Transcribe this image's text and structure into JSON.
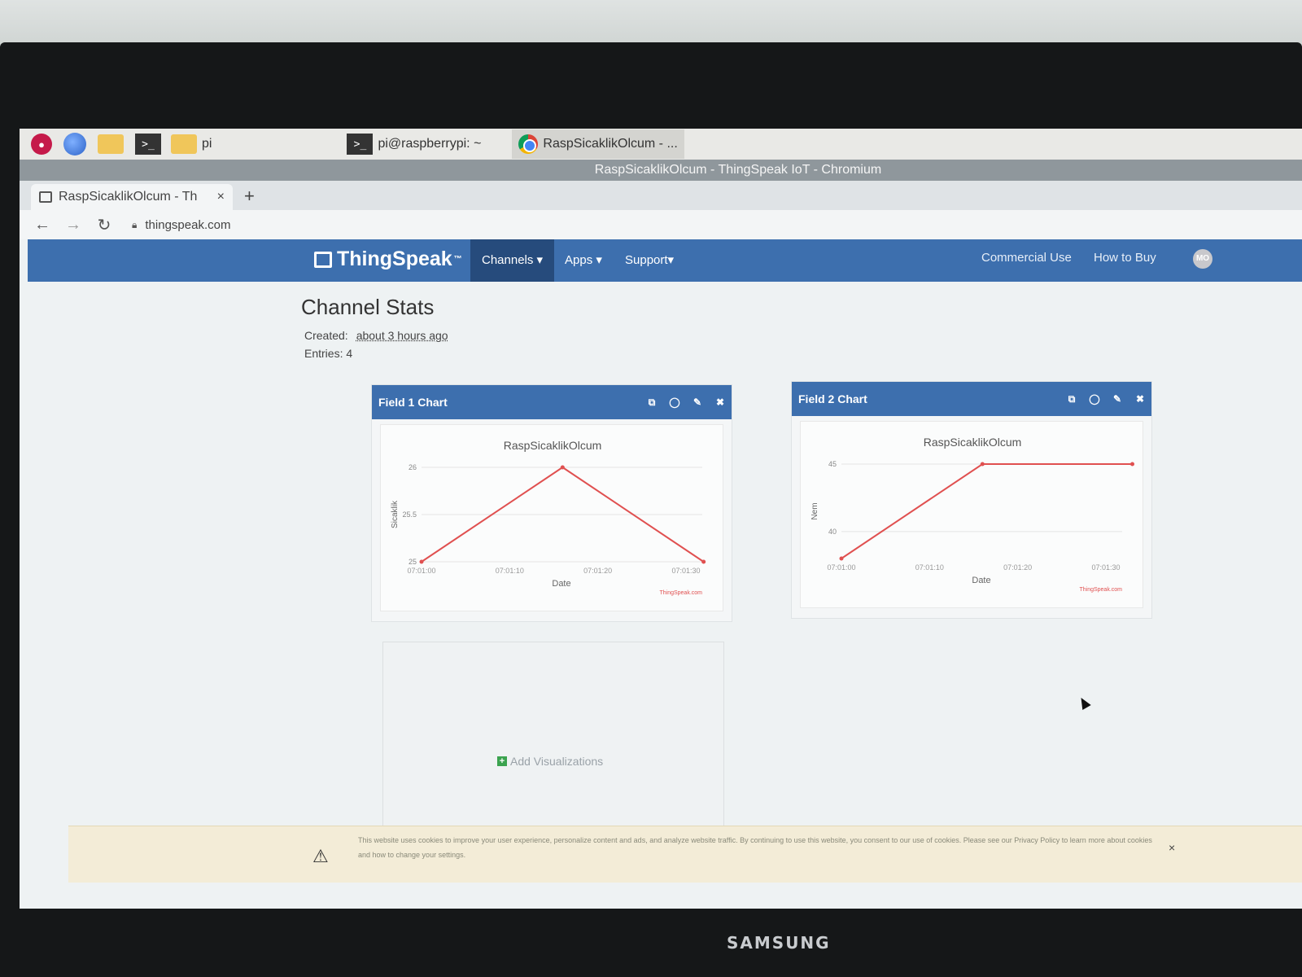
{
  "taskbar": {
    "folder_label": "pi",
    "tasks": [
      {
        "label": "pi@raspberrypi: ~"
      },
      {
        "label": "RaspSicaklikOlcum - ..."
      }
    ]
  },
  "window": {
    "title": "RaspSicaklikOlcum - ThingSpeak IoT - Chromium"
  },
  "browser": {
    "tab_title": "RaspSicaklikOlcum - Th",
    "tab_close": "×",
    "new_tab": "+",
    "url": "thingspeak.com"
  },
  "nav": {
    "logo": "ThingSpeak",
    "logo_tm": "™",
    "menus": [
      {
        "label": "Channels ▾"
      },
      {
        "label": "Apps ▾"
      },
      {
        "label": "Support▾"
      }
    ],
    "right": [
      {
        "label": "Commercial Use"
      },
      {
        "label": "How to Buy"
      }
    ],
    "avatar": "MO"
  },
  "stats": {
    "title": "Channel Stats",
    "created_label": "Created:",
    "created_value": "about 3 hours ago",
    "entries_label": "Entries:",
    "entries_value": "4"
  },
  "charts": [
    {
      "header": "Field 1 Chart"
    },
    {
      "header": "Field 2 Chart"
    }
  ],
  "chart_data": [
    {
      "type": "line",
      "title": "RaspSicaklikOlcum",
      "xlabel": "Date",
      "ylabel": "Sicaklik",
      "x_ticks": [
        "07:01:00",
        "07:01:10",
        "07:01:20",
        "07:01:30"
      ],
      "y_ticks": [
        25,
        25.5,
        26
      ],
      "ylim": [
        25,
        26
      ],
      "xlim_seconds": [
        0,
        30
      ],
      "points": [
        {
          "x": "07:01:00",
          "y": 25
        },
        {
          "x": "07:01:16",
          "y": 26
        },
        {
          "x": "07:01:32",
          "y": 25
        }
      ],
      "credit": "ThingSpeak.com",
      "color": "#e05050"
    },
    {
      "type": "line",
      "title": "RaspSicaklikOlcum",
      "xlabel": "Date",
      "ylabel": "Nem",
      "x_ticks": [
        "07:01:00",
        "07:01:10",
        "07:01:20",
        "07:01:30"
      ],
      "y_ticks": [
        40,
        45
      ],
      "ylim": [
        38,
        45
      ],
      "xlim_seconds": [
        0,
        30
      ],
      "points": [
        {
          "x": "07:01:00",
          "y": 38
        },
        {
          "x": "07:01:16",
          "y": 45
        },
        {
          "x": "07:01:33",
          "y": 45
        }
      ],
      "credit": "ThingSpeak.com",
      "color": "#e05050"
    }
  ],
  "add_viz": "Add Visualizations",
  "cookie": {
    "text": "This website uses cookies to improve your user experience, personalize content and ads, and analyze website traffic. By continuing to use this website, you consent to our use of cookies. Please see our Privacy Policy to learn more about cookies and how to change your settings.",
    "close": "×"
  },
  "monitor_brand": "SAMSUNG",
  "colors": {
    "nav": "#3d6fae",
    "nav_active": "#264b7c",
    "line": "#e05050"
  }
}
